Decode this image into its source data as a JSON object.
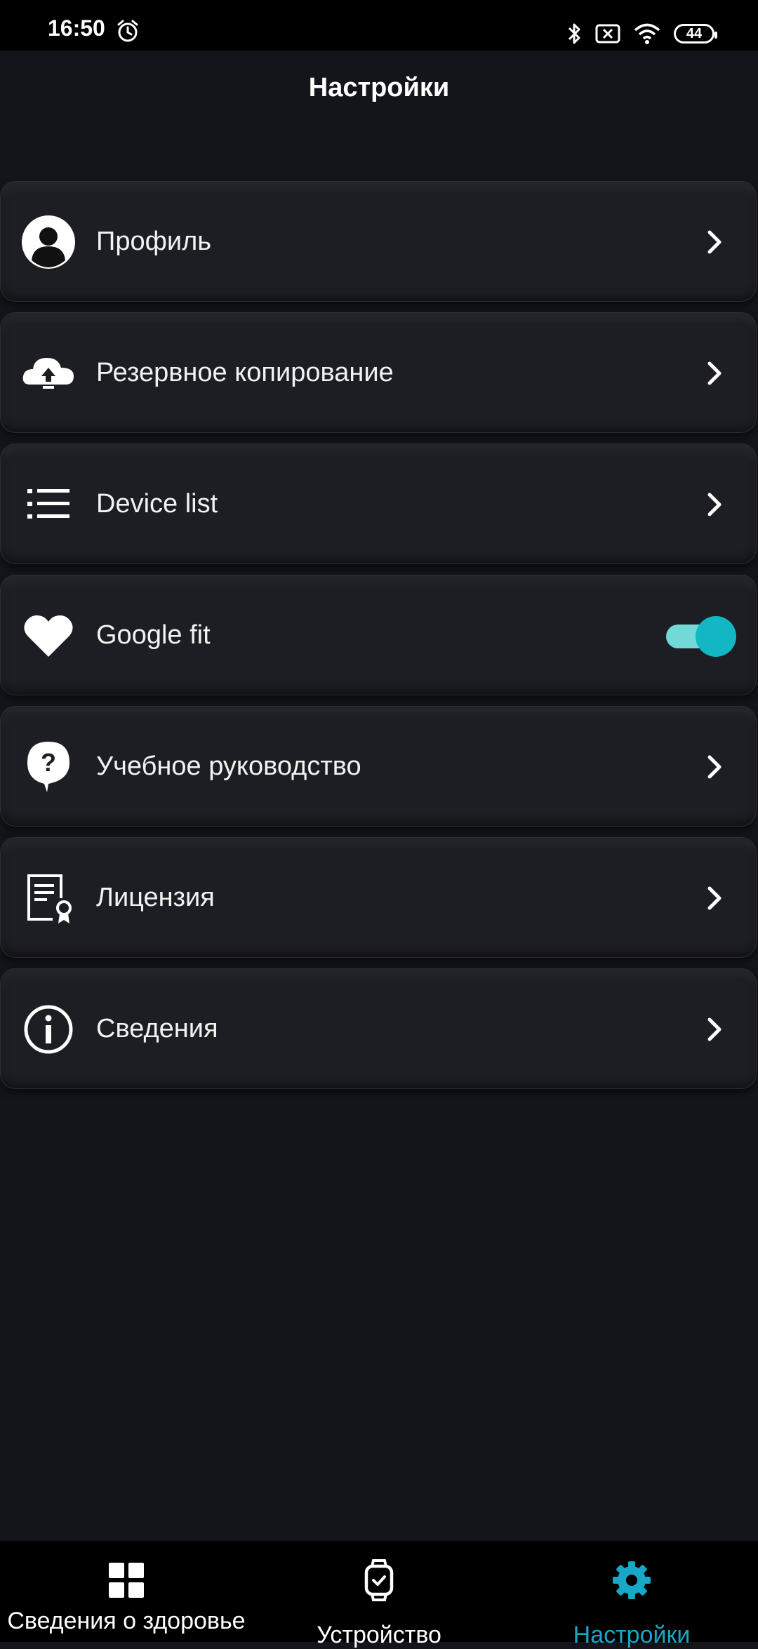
{
  "status_bar": {
    "time": "16:50",
    "battery": "44"
  },
  "header": {
    "title": "Настройки"
  },
  "menu": {
    "items": [
      {
        "label": "Профиль",
        "icon": "profile-icon"
      },
      {
        "label": "Резервное копирование",
        "icon": "cloud-upload-icon"
      },
      {
        "label": "Device list",
        "icon": "list-icon"
      },
      {
        "label": "Google fit",
        "icon": "heart-icon",
        "toggle": true,
        "toggle_on": true
      },
      {
        "label": "Учебное руководство",
        "icon": "help-icon"
      },
      {
        "label": "Лицензия",
        "icon": "license-icon"
      },
      {
        "label": "Сведения",
        "icon": "info-icon"
      }
    ]
  },
  "bottom_nav": {
    "items": [
      {
        "label": "Сведения о здоровье",
        "icon": "grid-icon"
      },
      {
        "label": "Устройство",
        "icon": "watch-icon"
      },
      {
        "label": "Настройки",
        "icon": "gear-icon",
        "active": true
      }
    ]
  },
  "colors": {
    "background": "#14151a",
    "accent": "#18a7c6",
    "toggle_track": "#73d9d6",
    "toggle_knob": "#13b7c3"
  }
}
